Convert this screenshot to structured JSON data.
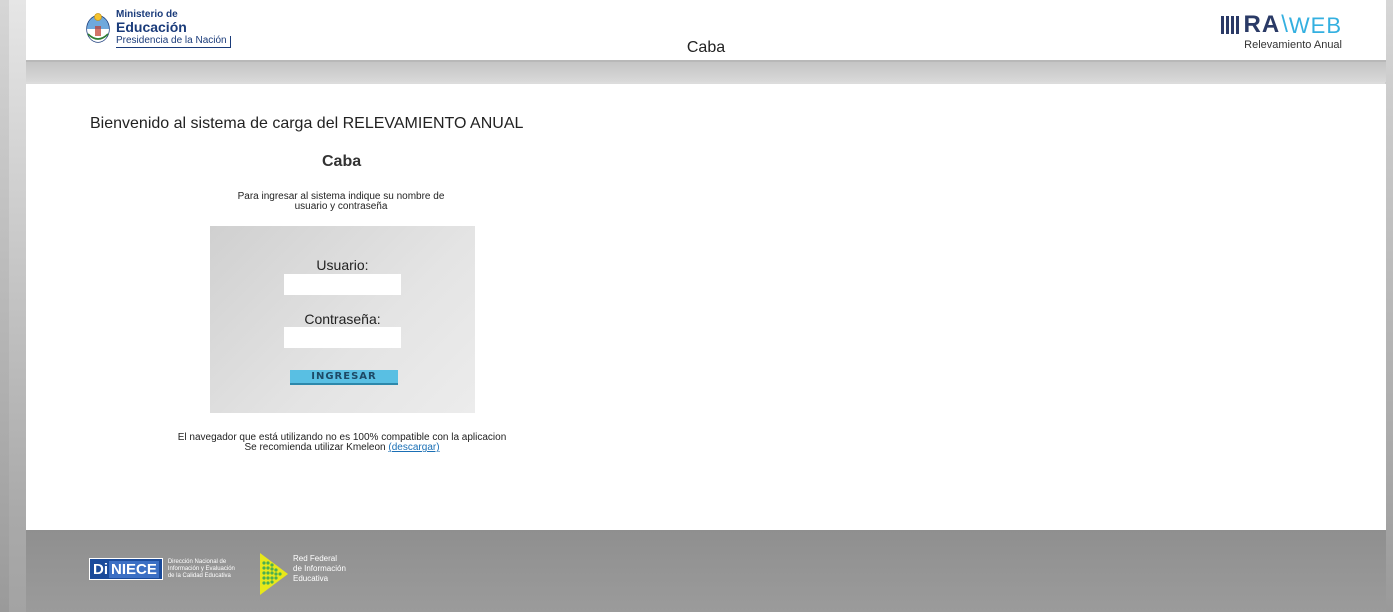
{
  "header": {
    "ministry_line1": "Ministerio de",
    "ministry_line2": "Educación",
    "ministry_line3": "Presidencia de la Nación",
    "title": "Caba",
    "raweb_ra": "RA",
    "raweb_web": "WEB",
    "raweb_subtitle": "Relevamiento Anual"
  },
  "main": {
    "welcome": "Bienvenido al sistema de carga del RELEVAMIENTO ANUAL",
    "jurisdiction": "Caba",
    "instructions_line1": "Para ingresar al sistema indique su nombre de",
    "instructions_line2": "usuario y contraseña",
    "login": {
      "user_label": "Usuario:",
      "user_value": "",
      "password_label": "Contraseña:",
      "password_value": "",
      "submit_label": "INGRESAR"
    },
    "browser_note_line1": "El navegador que está utilizando no es 100% compatible con la aplicacion",
    "browser_note_line2": "Se recomienda utilizar Kmeleon",
    "download_link": "(descargar)"
  },
  "footer": {
    "diniece_di": "Di",
    "diniece_niece": "NIECE",
    "diniece_line1": "Dirección Nacional de",
    "diniece_line2": "Información y Evaluación",
    "diniece_line3": "de la Calidad Educativa",
    "red_line1": "Red Federal",
    "red_line2": "de Información",
    "red_line3": "Educativa"
  },
  "colors": {
    "brand_navy": "#1a3b7a",
    "accent_blue": "#34b0e0",
    "button_blue": "#59bfe3",
    "link_blue": "#1a6fb5"
  }
}
